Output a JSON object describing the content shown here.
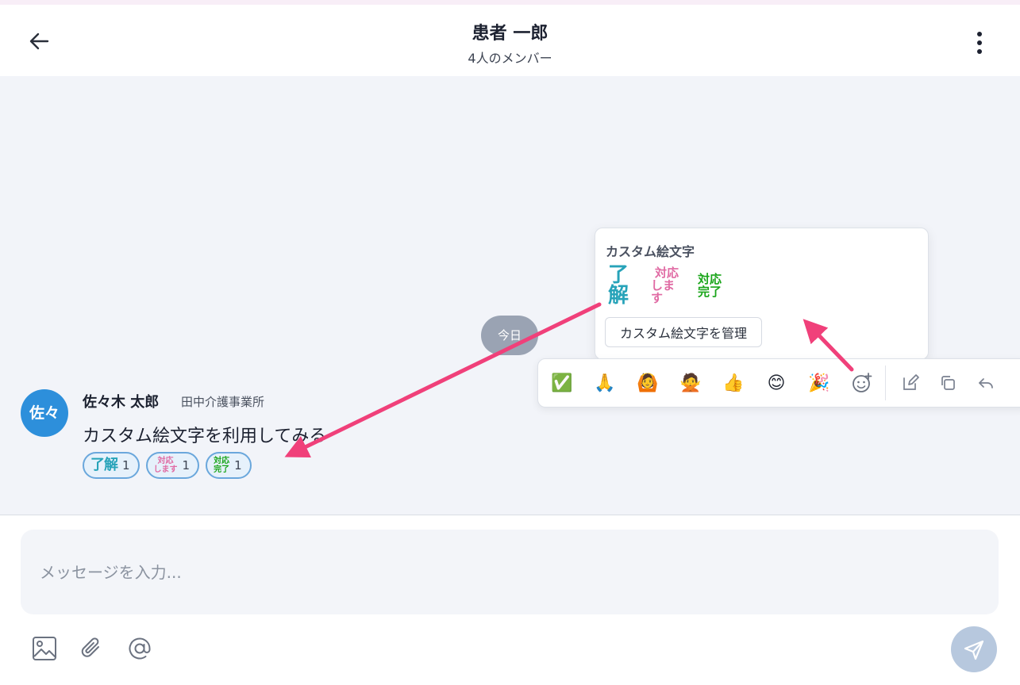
{
  "header": {
    "title": "患者 一郎",
    "subtitle": "4人のメンバー"
  },
  "chat": {
    "day_label": "今日",
    "message": {
      "avatar_text": "佐々",
      "sender": "佐々木 太郎",
      "organization": "田中介護事業所",
      "text": "カスタム絵文字を利用してみる",
      "reactions": [
        {
          "emoji": "了解",
          "count": "1"
        },
        {
          "emoji_line1": "対応",
          "emoji_line2": "します",
          "count": "1"
        },
        {
          "emoji_line1": "対応",
          "emoji_line2": "完了",
          "count": "1"
        }
      ]
    }
  },
  "popover": {
    "title": "カスタム絵文字",
    "emojis": {
      "ryokai": "了解",
      "taiou_line1": "対応",
      "taiou_line2": "します",
      "kanryo_line1": "対応",
      "kanryo_line2": "完了"
    },
    "manage_button": "カスタム絵文字を管理"
  },
  "toolbar": {
    "quick_reactions": [
      "✅",
      "🙏",
      "🙆",
      "🙅",
      "👍",
      "😊",
      "🎉"
    ]
  },
  "composer": {
    "placeholder": "メッセージを入力..."
  },
  "colors": {
    "accent_blue": "#2d8fdb",
    "arrow_pink": "#f0407a",
    "send_button": "#b7c8de"
  }
}
